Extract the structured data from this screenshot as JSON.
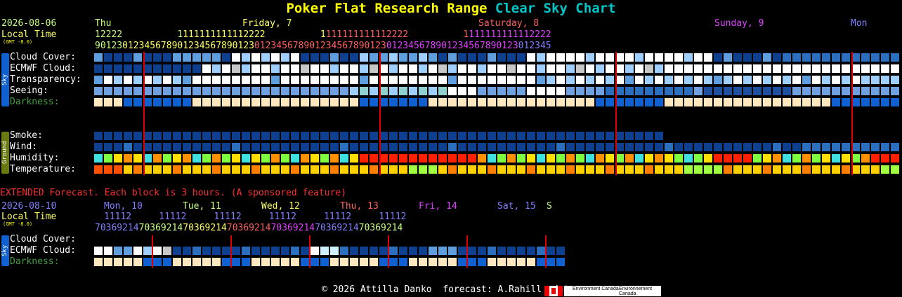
{
  "title": {
    "part1": "Poker Flat Research Range",
    "part2": "Clear Sky Chart"
  },
  "main": {
    "date": "2026-08-06",
    "local_time": "Local Time",
    "gmt": "(GMT -8.0)",
    "days": [
      {
        "label": "Thu",
        "color": "#c8ff80"
      },
      {
        "label": "Friday, 7",
        "color": "#ffff60"
      },
      {
        "label": "Saturday, 8",
        "color": "#ff6060"
      },
      {
        "label": "Sunday, 9",
        "color": "#e040ff"
      },
      {
        "label": "Mon",
        "color": "#8080ff"
      }
    ],
    "hour_tens": "12222          1111111111112222          1111111111112222          1111111111112222",
    "hour_units": "90123012345678901234567890123012345678901234567890123012345678901234567890123012345",
    "rows": [
      "Cloud Cover:",
      "ECMWF Cloud:",
      "Transparency:",
      "Seeing:",
      "Darkness:"
    ],
    "ground_rows": [
      "Smoke:",
      "Wind:",
      "Humidity:",
      "Temperature:"
    ],
    "sky_tab": "Sky",
    "ground_tab": "Ground"
  },
  "extended": {
    "heading": "EXTENDED Forecast. Each block is 3 hours. (A sponsored feature)",
    "date": "2026-08-10",
    "local_time": "Local Time",
    "gmt": "(GMT -8.0)",
    "days": [
      {
        "label": "Mon, 10",
        "color": "#8080ff"
      },
      {
        "label": "Tue, 11",
        "color": "#c8ff80"
      },
      {
        "label": "Wed, 12",
        "color": "#ffff60"
      },
      {
        "label": "Thu, 13",
        "color": "#ff6060"
      },
      {
        "label": "Fri, 14",
        "color": "#e040ff"
      },
      {
        "label": "Sat, 15",
        "color": "#8080ff"
      },
      {
        "label": "S",
        "color": "#c8ff80"
      }
    ],
    "hour_tens": "11112     11112     11112     11112     11112     11112",
    "hour_units": "70369214703692147036921470369214703692147036921470369214",
    "rows": [
      "Cloud Cover:",
      "ECMWF Cloud:",
      "Darkness:"
    ],
    "sky_tab": "Sky"
  },
  "footer": {
    "copyright": "© 2026 Attilla Danko  forecast: A.Rahill  data:",
    "env_en": "Environment Canada",
    "env_fr": "Environnement Canada"
  },
  "colors": {
    "overcast": "#0f3f8f",
    "cloud_mid": "#2d6fbf",
    "cloud_light": "#5f9fdf",
    "cloud_pale": "#9fcfff",
    "clear": "#ffffff",
    "grey": "#c8c8c8",
    "seeing_blue": "#6fa0e0",
    "dark_blue": "#1060d0",
    "darkness_pale": "#ffe8c0",
    "humidity_yellow": "#ffe000",
    "humidity_orange": "#ff9000",
    "humidity_red": "#ff2000",
    "temp_orange": "#ff8000",
    "temp_yellow": "#ffd000"
  }
}
